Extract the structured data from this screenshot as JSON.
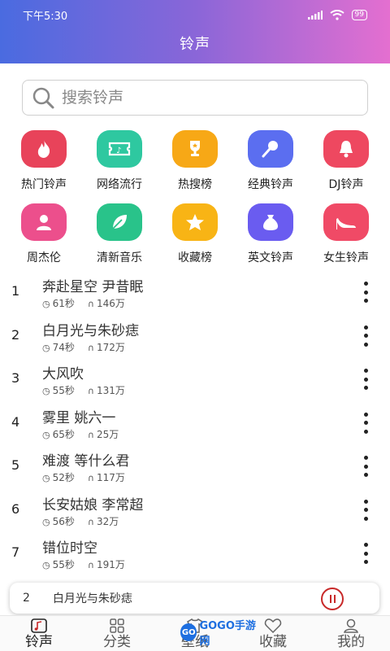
{
  "status_bar": {
    "time": "下午5:30",
    "battery": "99"
  },
  "header": {
    "title": "铃声"
  },
  "search": {
    "placeholder": "搜索铃声"
  },
  "categories": [
    {
      "label": "热门铃声",
      "icon": "flame-icon",
      "color": "#e8435a"
    },
    {
      "label": "网络流行",
      "icon": "ticket-icon",
      "color": "#2ec8a0"
    },
    {
      "label": "热搜榜",
      "icon": "trophy-icon",
      "color": "#f7a816"
    },
    {
      "label": "经典铃声",
      "icon": "microphone-icon",
      "color": "#5b6ef0"
    },
    {
      "label": "DJ铃声",
      "icon": "bell-icon",
      "color": "#ee4860"
    },
    {
      "label": "周杰伦",
      "icon": "person-icon",
      "color": "#ec4f8c"
    },
    {
      "label": "清新音乐",
      "icon": "leaf-icon",
      "color": "#29c38a"
    },
    {
      "label": "收藏榜",
      "icon": "star-icon",
      "color": "#f8b415"
    },
    {
      "label": "英文铃声",
      "icon": "money-bag-icon",
      "color": "#6a5cf0"
    },
    {
      "label": "女生铃声",
      "icon": "high-heel-icon",
      "color": "#f04a66"
    }
  ],
  "songs": [
    {
      "index": "1",
      "title": "奔赴星空 尹昔眠",
      "duration": "61秒",
      "plays": "146万"
    },
    {
      "index": "2",
      "title": "白月光与朱砂痣",
      "duration": "74秒",
      "plays": "172万"
    },
    {
      "index": "3",
      "title": "大风吹",
      "duration": "55秒",
      "plays": "131万"
    },
    {
      "index": "4",
      "title": "雾里 姚六一",
      "duration": "65秒",
      "plays": "25万"
    },
    {
      "index": "5",
      "title": "难渡 等什么君",
      "duration": "52秒",
      "plays": "117万"
    },
    {
      "index": "6",
      "title": "长安姑娘 李常超",
      "duration": "56秒",
      "plays": "32万"
    },
    {
      "index": "7",
      "title": "错位时空",
      "duration": "55秒",
      "plays": "191万"
    }
  ],
  "player": {
    "index": "2",
    "title": "白月光与朱砂痣"
  },
  "tabs": [
    {
      "label": "铃声",
      "icon": "music-note-icon",
      "active": true
    },
    {
      "label": "分类",
      "icon": "grid-icon",
      "active": false
    },
    {
      "label": "壁纸",
      "icon": "shirt-icon",
      "active": false
    },
    {
      "label": "收藏",
      "icon": "heart-icon",
      "active": false
    },
    {
      "label": "我的",
      "icon": "user-icon",
      "active": false
    }
  ],
  "watermark": {
    "text": "GOGO手游网"
  }
}
